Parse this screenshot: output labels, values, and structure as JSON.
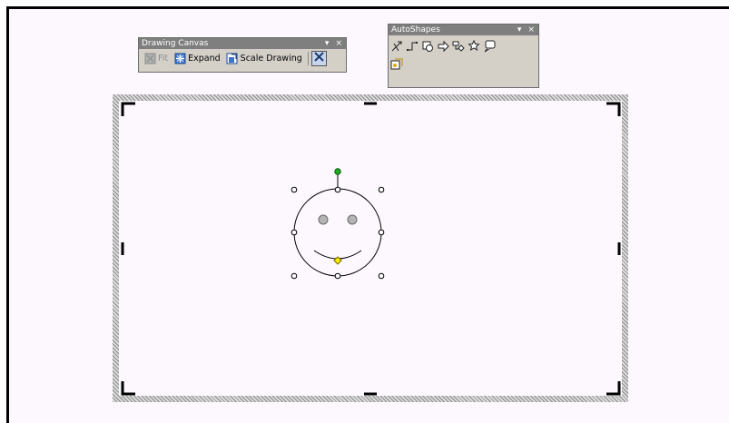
{
  "drawing_canvas_toolbar": {
    "title": "Drawing Canvas",
    "fit_label": "Fit",
    "expand_label": "Expand",
    "scale_label": "Scale Drawing"
  },
  "autoshapes_toolbar": {
    "title": "AutoShapes"
  },
  "title_controls": {
    "dropdown": "▾",
    "close": "×"
  },
  "colors": {
    "page_background": "#fdf8fd",
    "toolbar_face": "#d4d0c8",
    "toolbar_titlebar": "#7f7f7f",
    "rotation_handle": "#22aa22",
    "adjust_handle": "#ffee00"
  },
  "icons": {
    "fit": "fit-icon",
    "expand": "expand-icon",
    "scale": "scale-drawing-icon",
    "text_wrapping": "text-wrapping-icon",
    "autoshapes": [
      "lines-icon",
      "connectors-icon",
      "basic-shapes-icon",
      "block-arrows-icon",
      "flowchart-icon",
      "stars-banners-icon",
      "callouts-icon",
      "more-autoshapes-icon"
    ]
  },
  "canvas": {
    "shape": "smiley-face"
  }
}
